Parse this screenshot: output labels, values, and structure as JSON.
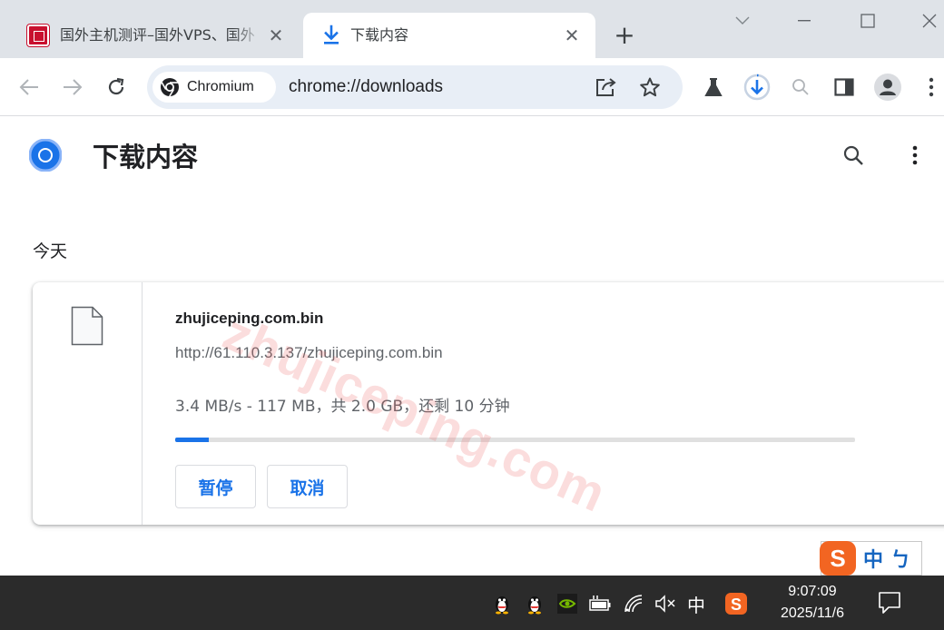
{
  "tabs": [
    {
      "title": "国外主机测评–国外VPS、国外",
      "active": false
    },
    {
      "title": "下载内容",
      "active": true
    }
  ],
  "toolbar": {
    "site_chip": "Chromium",
    "url": "chrome://downloads"
  },
  "page": {
    "title": "下载内容",
    "day_label": "今天"
  },
  "download": {
    "file_name": "zhujiceping.com.bin",
    "url": "http://61.110.3.137/zhujiceping.com.bin",
    "status": "3.4 MB/s - 117 MB，共 2.0 GB，还剩 10 分钟",
    "progress": 0.05,
    "pause_label": "暂停",
    "cancel_label": "取消"
  },
  "watermark": "zhujiceping.com",
  "ime": {
    "logo": "S",
    "mode": "中",
    "punct": "ㄅ"
  },
  "taskbar": {
    "ime_indicator": "中",
    "time": "9:07:09",
    "date": "2025/11/6"
  },
  "colors": {
    "accent": "#1a73e8",
    "tabstrip": "#dfe3e8",
    "omnibox": "#e8eef6",
    "taskbar": "#2b2b2b",
    "ime_brand": "#f26522"
  }
}
